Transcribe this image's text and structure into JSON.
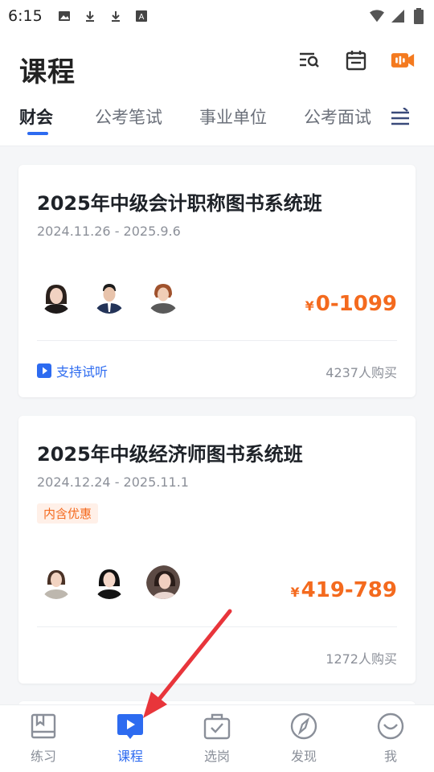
{
  "status_bar": {
    "time": "6:15",
    "left_icons": [
      "image-icon",
      "download-icon",
      "download-icon",
      "text-a-icon"
    ],
    "right_icons": [
      "wifi-icon",
      "signal-icon",
      "battery-icon"
    ]
  },
  "header": {
    "title": "课程",
    "actions": [
      "search-list-icon",
      "calendar-icon",
      "live-video-icon"
    ],
    "accent_color": "#2d6bf0",
    "live_icon_color": "#f47a1f"
  },
  "tabs": [
    {
      "label": "财会",
      "active": true
    },
    {
      "label": "公考笔试",
      "active": false
    },
    {
      "label": "事业单位",
      "active": false
    },
    {
      "label": "公考面试",
      "active": false
    }
  ],
  "courses": [
    {
      "title": "2025年中级会计职称图书系统班",
      "date_range": "2024.11.26 - 2025.9.6",
      "price_symbol": "¥",
      "price": "0-1099",
      "trial_label": "支持试听",
      "sold": "4237人购买"
    },
    {
      "title": "2025年中级经济师图书系统班",
      "date_range": "2024.12.24 - 2025.11.1",
      "badge": "内含优惠",
      "price_symbol": "¥",
      "price": "419-789",
      "sold": "1272人购买"
    }
  ],
  "bottom_nav": [
    {
      "label": "练习",
      "icon": "book-icon",
      "active": false
    },
    {
      "label": "课程",
      "icon": "play-icon",
      "active": true
    },
    {
      "label": "选岗",
      "icon": "briefcase-check-icon",
      "active": false
    },
    {
      "label": "发现",
      "icon": "compass-icon",
      "active": false
    },
    {
      "label": "我",
      "icon": "smile-icon",
      "active": false
    }
  ],
  "colors": {
    "price": "#f46a1e",
    "annotation_arrow": "#e8353b"
  }
}
